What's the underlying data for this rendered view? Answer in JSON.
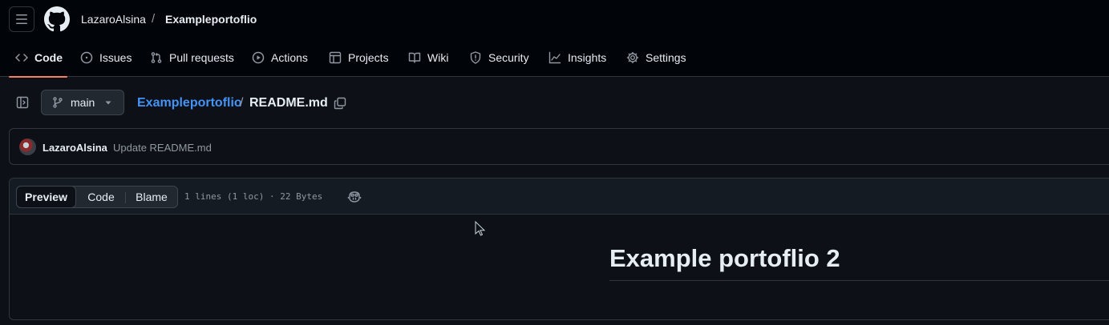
{
  "header": {
    "owner": "LazaroAlsina",
    "separator": "/",
    "repo": "Exampleportoflio"
  },
  "nav": {
    "items": [
      {
        "label": "Code",
        "icon": "code-icon",
        "active": true
      },
      {
        "label": "Issues",
        "icon": "issue-icon"
      },
      {
        "label": "Pull requests",
        "icon": "pull-request-icon"
      },
      {
        "label": "Actions",
        "icon": "play-icon"
      },
      {
        "label": "Projects",
        "icon": "table-icon"
      },
      {
        "label": "Wiki",
        "icon": "book-icon"
      },
      {
        "label": "Security",
        "icon": "shield-icon"
      },
      {
        "label": "Insights",
        "icon": "graph-icon"
      },
      {
        "label": "Settings",
        "icon": "gear-icon"
      }
    ]
  },
  "file_path": {
    "branch": "main",
    "repo": "Exampleportoflio",
    "separator": "/",
    "file": "README.md"
  },
  "commit": {
    "author": "LazaroAlsina",
    "message": "Update README.md"
  },
  "file_view": {
    "tabs": [
      {
        "label": "Preview",
        "active": true
      },
      {
        "label": "Code"
      },
      {
        "label": "Blame"
      }
    ],
    "stats": "1 lines (1 loc) · 22 Bytes"
  },
  "readme": {
    "title": "Example portoflio 2"
  },
  "colors": {
    "background": "#0d1117",
    "header_bg": "#010409",
    "link": "#4493f8",
    "active_underline": "#f78166"
  }
}
